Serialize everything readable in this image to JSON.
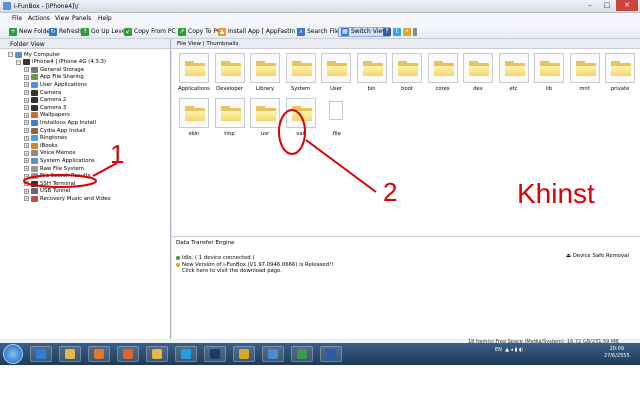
{
  "window": {
    "title": "i-FunBox - [iPhone4]\\/"
  },
  "menu": [
    "File",
    "Actions",
    "View",
    "Panels",
    "Help"
  ],
  "toolbar": [
    {
      "label": "New Folder",
      "icon": "new-folder-icon",
      "color": "#2e9e3c"
    },
    {
      "label": "Refresh",
      "icon": "refresh-icon",
      "color": "#2e7bd1"
    },
    {
      "label": "Go Up Level",
      "icon": "up-level-icon",
      "color": "#2e9e3c"
    },
    {
      "label": "Copy From PC",
      "icon": "copy-from-pc-icon",
      "color": "#2e9e3c"
    },
    {
      "label": "Copy To PC",
      "icon": "copy-to-pc-icon",
      "color": "#2e9e3c"
    },
    {
      "label": "Install App [ AppFastIn™ ]",
      "icon": "install-app-icon",
      "color": "#e39b2a"
    },
    {
      "label": "Search Files",
      "icon": "search-icon",
      "color": "#3a79c9"
    },
    {
      "label": "Switch View",
      "icon": "switch-view-icon",
      "color": "#3a79c9"
    }
  ],
  "left_panel": {
    "header": "Folder View",
    "tree": [
      {
        "label": "My Computer",
        "level": 0,
        "icon": "computer-icon",
        "color": "#5a8ecf"
      },
      {
        "label": "iPhone4 | iPhone 4G (4.3.3)",
        "level": 1,
        "icon": "iphone-icon",
        "color": "#333333"
      },
      {
        "label": "General Storage",
        "level": 2,
        "icon": "storage-icon",
        "color": "#777777"
      },
      {
        "label": "App File Sharing",
        "level": 2,
        "icon": "app-sharing-icon",
        "color": "#5c9c4c"
      },
      {
        "label": "User Applications",
        "level": 2,
        "icon": "apps-icon",
        "color": "#5a8ecf"
      },
      {
        "label": "Camera",
        "level": 2,
        "icon": "camera-icon",
        "color": "#333333"
      },
      {
        "label": "Camera 2",
        "level": 2,
        "icon": "camera-icon",
        "color": "#333333"
      },
      {
        "label": "Camera 3",
        "level": 2,
        "icon": "camera-icon",
        "color": "#333333"
      },
      {
        "label": "Wallpapers",
        "level": 2,
        "icon": "wallpaper-icon",
        "color": "#cc6633"
      },
      {
        "label": "Installous App Install",
        "level": 2,
        "icon": "installous-icon",
        "color": "#4a78c2"
      },
      {
        "label": "Cydia App Install",
        "level": 2,
        "icon": "cydia-icon",
        "color": "#8a6a3a"
      },
      {
        "label": "Ringtones",
        "level": 2,
        "icon": "ringtone-icon",
        "color": "#4aa0d0"
      },
      {
        "label": "iBooks",
        "level": 2,
        "icon": "ibooks-icon",
        "color": "#d08a2a"
      },
      {
        "label": "Voice Memos",
        "level": 2,
        "icon": "voice-memo-icon",
        "color": "#888888"
      },
      {
        "label": "System Applications",
        "level": 2,
        "icon": "system-apps-icon",
        "color": "#5a8ecf"
      },
      {
        "label": "Raw File System",
        "level": 2,
        "icon": "raw-fs-icon",
        "color": "#999999"
      },
      {
        "label": "File Search Results",
        "level": 2,
        "icon": "search-results-icon",
        "color": "#999999"
      },
      {
        "label": "SSH Terminal",
        "level": 2,
        "icon": "terminal-icon",
        "color": "#333333"
      },
      {
        "label": "USB Tunnel",
        "level": 2,
        "icon": "usb-icon",
        "color": "#666666"
      },
      {
        "label": "Recovery Music and Video",
        "level": 2,
        "icon": "recovery-icon",
        "color": "#c44a4a"
      }
    ]
  },
  "view_tabs": "File View | Thumbnails",
  "files": [
    {
      "name": "Applications",
      "type": "folder"
    },
    {
      "name": "Developer",
      "type": "folder"
    },
    {
      "name": "Library",
      "type": "folder"
    },
    {
      "name": "System",
      "type": "folder"
    },
    {
      "name": "User",
      "type": "folder"
    },
    {
      "name": "bin",
      "type": "folder"
    },
    {
      "name": "boot",
      "type": "folder"
    },
    {
      "name": "cores",
      "type": "folder"
    },
    {
      "name": "dev",
      "type": "folder"
    },
    {
      "name": "etc",
      "type": "folder"
    },
    {
      "name": "lib",
      "type": "folder"
    },
    {
      "name": "mnt",
      "type": "folder"
    },
    {
      "name": "private",
      "type": "folder"
    },
    {
      "name": "sbin",
      "type": "folder"
    },
    {
      "name": "tmp",
      "type": "folder"
    },
    {
      "name": "usr",
      "type": "folder"
    },
    {
      "name": "var",
      "type": "folder"
    },
    {
      "name": ".file",
      "type": "file"
    }
  ],
  "transfer": {
    "title": "Data Transfer Engine",
    "safe_removal": "Device Safe Removal",
    "status": "Idle.  ( 1 device connected )",
    "update": "New Version of i-FunBox (V1.97.0946.0666) is Released!!",
    "download": "Click here to visit the download page."
  },
  "status_bar": "18 Item(s)      Free Space (Media/System): 16.72 GB/231.59 MB",
  "taskbar": {
    "apps": [
      {
        "icon": "ie-icon",
        "color": "#2b7fd6"
      },
      {
        "icon": "explorer-icon",
        "color": "#e5b84a"
      },
      {
        "icon": "media-player-icon",
        "color": "#e07a2a"
      },
      {
        "icon": "firefox-icon",
        "color": "#e0652a"
      },
      {
        "icon": "folder-icon",
        "color": "#e5b84a"
      },
      {
        "icon": "skype-icon",
        "color": "#1fa0e0"
      },
      {
        "icon": "photoshop-icon",
        "color": "#1a3a6a"
      },
      {
        "icon": "chrome-icon",
        "color": "#d8a82a"
      },
      {
        "icon": "itunes-icon",
        "color": "#4a8ad0"
      },
      {
        "icon": "ifunbox-icon",
        "color": "#3a9a4a"
      },
      {
        "icon": "word-icon",
        "color": "#2a5aa8"
      }
    ],
    "lang": "EN",
    "time": "20:09",
    "date": "27/6/2555"
  },
  "annotations": {
    "one": "1",
    "two": "2",
    "signature": "Khinst",
    "color": "#dd0000"
  }
}
